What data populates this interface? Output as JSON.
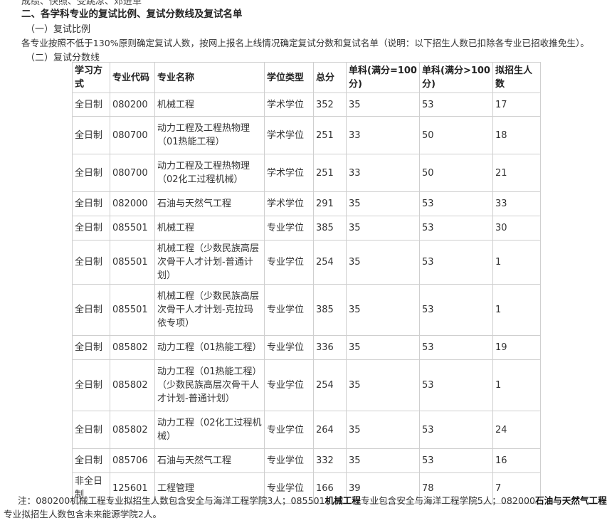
{
  "top_cut": "成绩、快照、受跳凉、邓进单",
  "section_title": "二、各学科专业的复试比例、复试分数线及复试名单",
  "sub1": "（一）复试比例",
  "description": "各专业按照不低于130%原则确定复试人数，按网上报名上线情况确定复试分数和复试名单（说明：以下招生人数已扣除各专业已招收推免生）。",
  "sub2": "（二）复试分数线",
  "table": {
    "headers": [
      "学习方式",
      "专业代码",
      "专业名称",
      "学位类型",
      "总分",
      "单科(满分=100分)",
      "单科(满分>100分)",
      "拟招生人数"
    ],
    "rows": [
      [
        "全日制",
        "080200",
        "机械工程",
        "学术学位",
        "352",
        "35",
        "53",
        "17"
      ],
      [
        "全日制",
        "080700",
        "动力工程及工程热物理（01热能工程）",
        "学术学位",
        "251",
        "33",
        "50",
        "18"
      ],
      [
        "全日制",
        "080700",
        "动力工程及工程热物理（02化工过程机械）",
        "学术学位",
        "251",
        "33",
        "50",
        "21"
      ],
      [
        "全日制",
        "082000",
        "石油与天然气工程",
        "学术学位",
        "291",
        "35",
        "53",
        "33"
      ],
      [
        "全日制",
        "085501",
        "机械工程",
        "专业学位",
        "385",
        "35",
        "53",
        "30"
      ],
      [
        "全日制",
        "085501",
        "机械工程（少数民族高层次骨干人才计划-普通计划）",
        "专业学位",
        "254",
        "35",
        "53",
        "1"
      ],
      [
        "全日制",
        "085501",
        "机械工程（少数民族高层次骨干人才计划-克拉玛依专项）",
        "专业学位",
        "385",
        "35",
        "53",
        "1"
      ],
      [
        "全日制",
        "085802",
        "动力工程（01热能工程）",
        "专业学位",
        "336",
        "35",
        "53",
        "19"
      ],
      [
        "全日制",
        "085802",
        "动力工程（01热能工程）（少数民族高层次骨干人才计划-普通计划）",
        "专业学位",
        "254",
        "35",
        "53",
        "1"
      ],
      [
        "全日制",
        "085802",
        "动力工程（02化工过程机械）",
        "专业学位",
        "264",
        "35",
        "53",
        "24"
      ],
      [
        "全日制",
        "085706",
        "石油与天然气工程",
        "专业学位",
        "332",
        "35",
        "53",
        "16"
      ],
      [
        "非全日制",
        "125601",
        "工程管理",
        "专业学位",
        "166",
        "39",
        "78",
        "7"
      ]
    ]
  },
  "note": {
    "prefix": "注：080200机械工程专业拟招生人数包含安全与海洋工程学院3人；085501",
    "bold1": "机械工程",
    "mid": "专业包含安全与海洋工程学院5人；082000",
    "bold2": "石油与天然气工程",
    "suffix": "专业拟招生人数包含未来能源学院2人。"
  }
}
